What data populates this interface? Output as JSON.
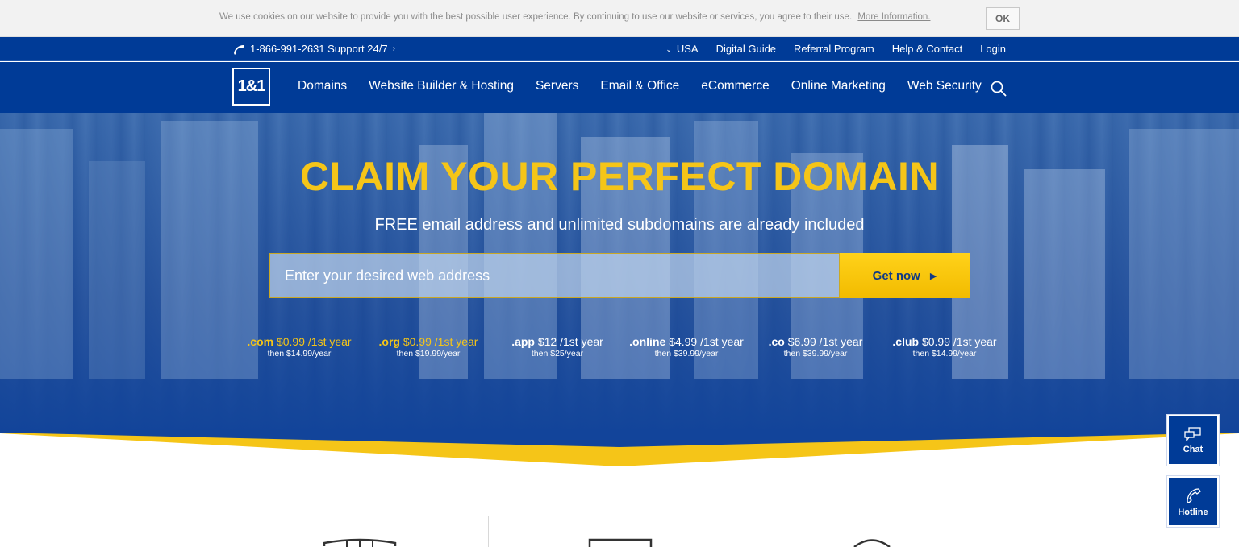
{
  "cookie": {
    "text": "We use cookies on our website to provide you with the best possible user experience. By continuing to use our website or services, you agree to their use.",
    "link": "More Information.",
    "ok": "OK"
  },
  "topbar": {
    "phone": "1-866-991-2631 Support 24/7",
    "chevron": "›",
    "country": "USA",
    "links": [
      "Digital Guide",
      "Referral Program",
      "Help & Contact",
      "Login"
    ]
  },
  "nav": {
    "logo": "1&1",
    "items": [
      "Domains",
      "Website Builder & Hosting",
      "Servers",
      "Email & Office",
      "eCommerce",
      "Online Marketing",
      "Web Security"
    ]
  },
  "hero": {
    "title": "CLAIM YOUR PERFECT DOMAIN",
    "subtitle": "FREE email address and unlimited subdomains are already included",
    "input_placeholder": "Enter your desired web address",
    "button": "Get now"
  },
  "tlds": [
    {
      "ext": ".com",
      "price": "$0.99 /1st year",
      "then": "then $14.99/year",
      "highlight": true
    },
    {
      "ext": ".org",
      "price": "$0.99 /1st year",
      "then": "then $19.99/year",
      "highlight": true
    },
    {
      "ext": ".app",
      "price": "$12 /1st year",
      "then": "then $25/year",
      "highlight": false
    },
    {
      "ext": ".online",
      "price": "$4.99 /1st year",
      "then": "then $39.99/year",
      "highlight": false
    },
    {
      "ext": ".co",
      "price": "$6.99 /1st year",
      "then": "then $39.99/year",
      "highlight": false
    },
    {
      "ext": ".club",
      "price": "$0.99 /1st year",
      "then": "then $14.99/year",
      "highlight": false
    }
  ],
  "side": {
    "chat": "Chat",
    "hotline": "Hotline"
  },
  "colors": {
    "brand_blue": "#003b97",
    "accent_yellow": "#f5c518"
  }
}
